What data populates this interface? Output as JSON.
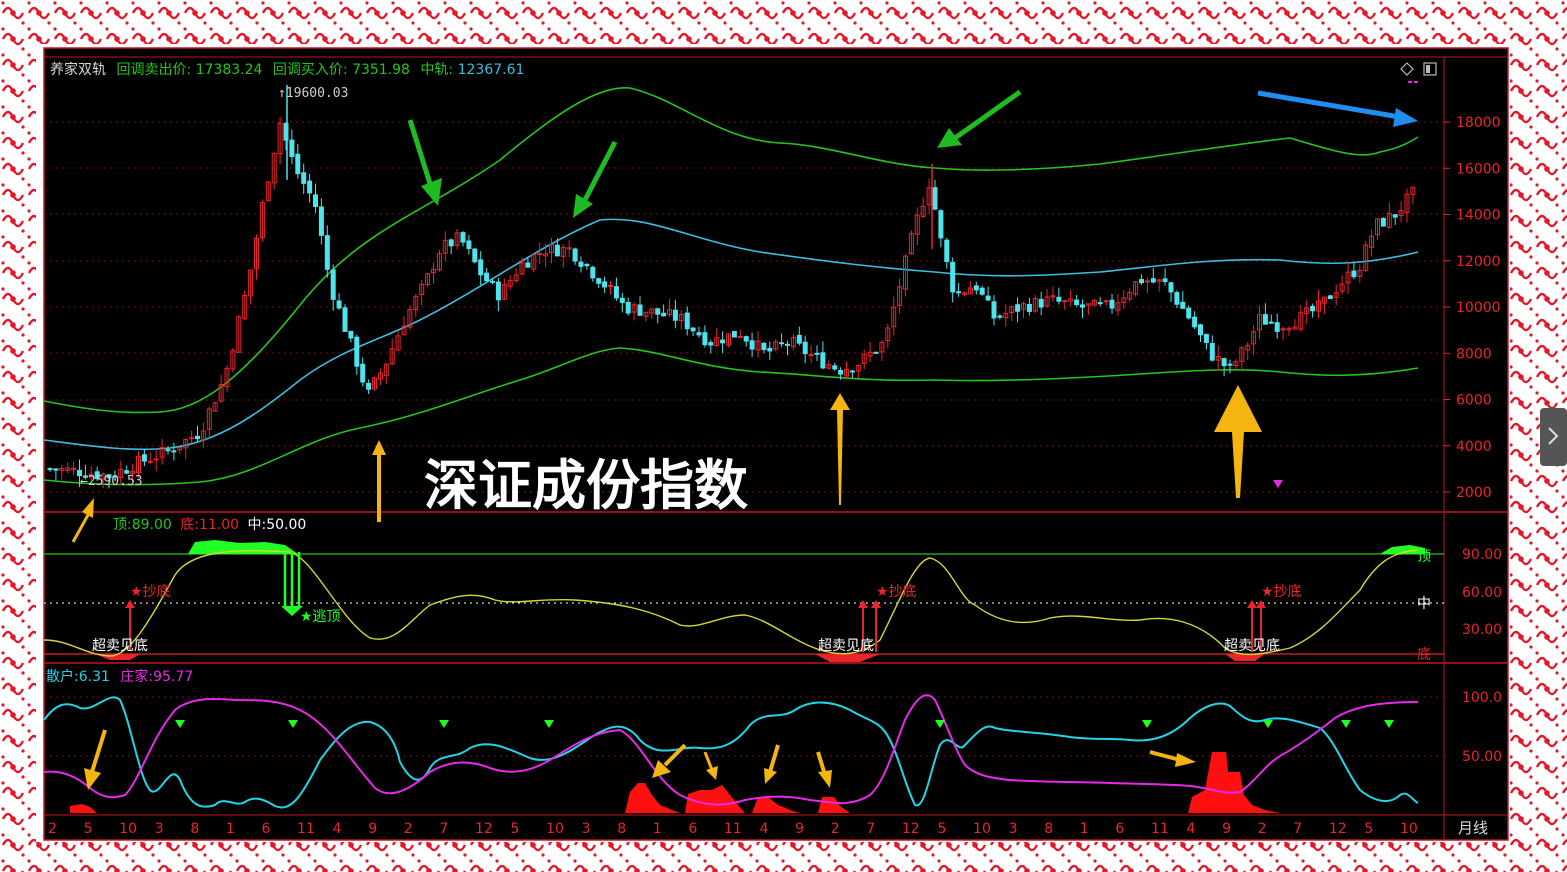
{
  "header": {
    "indicator_name": "养家双轨",
    "sell_label": "回调卖出价:",
    "sell_value": "17383.24",
    "buy_label": "回调买入价:",
    "buy_value": "7351.98",
    "mid_label": "中轨:",
    "mid_value": "12367.61"
  },
  "colors": {
    "background": "#000000",
    "border": "#e8182a",
    "up_candle": "#e8242c",
    "down_candle": "#4fe3ee",
    "band_outer": "#27c41d",
    "band_mid": "#3dbde0",
    "osc_line": "#d6d63a",
    "osc_green": "#22ff22",
    "retail_line": "#22d4e6",
    "dealer_line": "#e52be5",
    "arrow_yellow": "#f5b511",
    "arrow_green": "#1fbb22",
    "arrow_blue": "#1e8ff0"
  },
  "main_panel": {
    "high_label": "19600.03",
    "low_label": "2590.53",
    "watermark": "深证成份指数",
    "y_ticks": [
      "18000",
      "16000",
      "14000",
      "12000",
      "10000",
      "8000",
      "6000",
      "4000",
      "2000"
    ]
  },
  "osc_panel": {
    "top_label": "顶:",
    "top_value": "89.00",
    "bottom_label": "底:",
    "bottom_value": "11.00",
    "mid_label": "中:",
    "mid_value": "50.00",
    "y_ticks": [
      "90.00",
      "60.00",
      "30.00"
    ],
    "right_tags": {
      "top": "顶",
      "mid": "中",
      "bottom": "底"
    },
    "signals": {
      "buy": "★抄底",
      "sell": "★逃顶",
      "oversold": "超卖见底"
    }
  },
  "flow_panel": {
    "retail_label": "散户:",
    "retail_value": "6.31",
    "dealer_label": "庄家:",
    "dealer_value": "95.77",
    "y_ticks": [
      "100.0",
      "50.00"
    ]
  },
  "x_axis": {
    "ticks": [
      "2",
      "5",
      "10",
      "3",
      "8",
      "1",
      "6",
      "11",
      "4",
      "9",
      "2",
      "7",
      "12",
      "5",
      "10",
      "3",
      "8",
      "1",
      "6",
      "11",
      "4",
      "9",
      "2",
      "7",
      "12",
      "5",
      "10",
      "3",
      "8",
      "1",
      "6",
      "11",
      "4",
      "9",
      "2",
      "7",
      "12",
      "5",
      "10"
    ],
    "period": "月线"
  },
  "chart_data": {
    "type": "candlestick",
    "y_unit": "index points",
    "ylim": [
      1500,
      19800
    ],
    "series": [
      {
        "name": "中轨",
        "last": 12367.61
      },
      {
        "name": "回调卖出价",
        "last": 17383.24
      },
      {
        "name": "回调买入价",
        "last": 7351.98
      }
    ],
    "marked_high": 19600.03,
    "marked_low": 2590.53,
    "oscillator": {
      "top": 89.0,
      "bottom": 11.0,
      "mid": 50.0
    },
    "flow": {
      "散户": 6.31,
      "庄家": 95.77
    }
  }
}
